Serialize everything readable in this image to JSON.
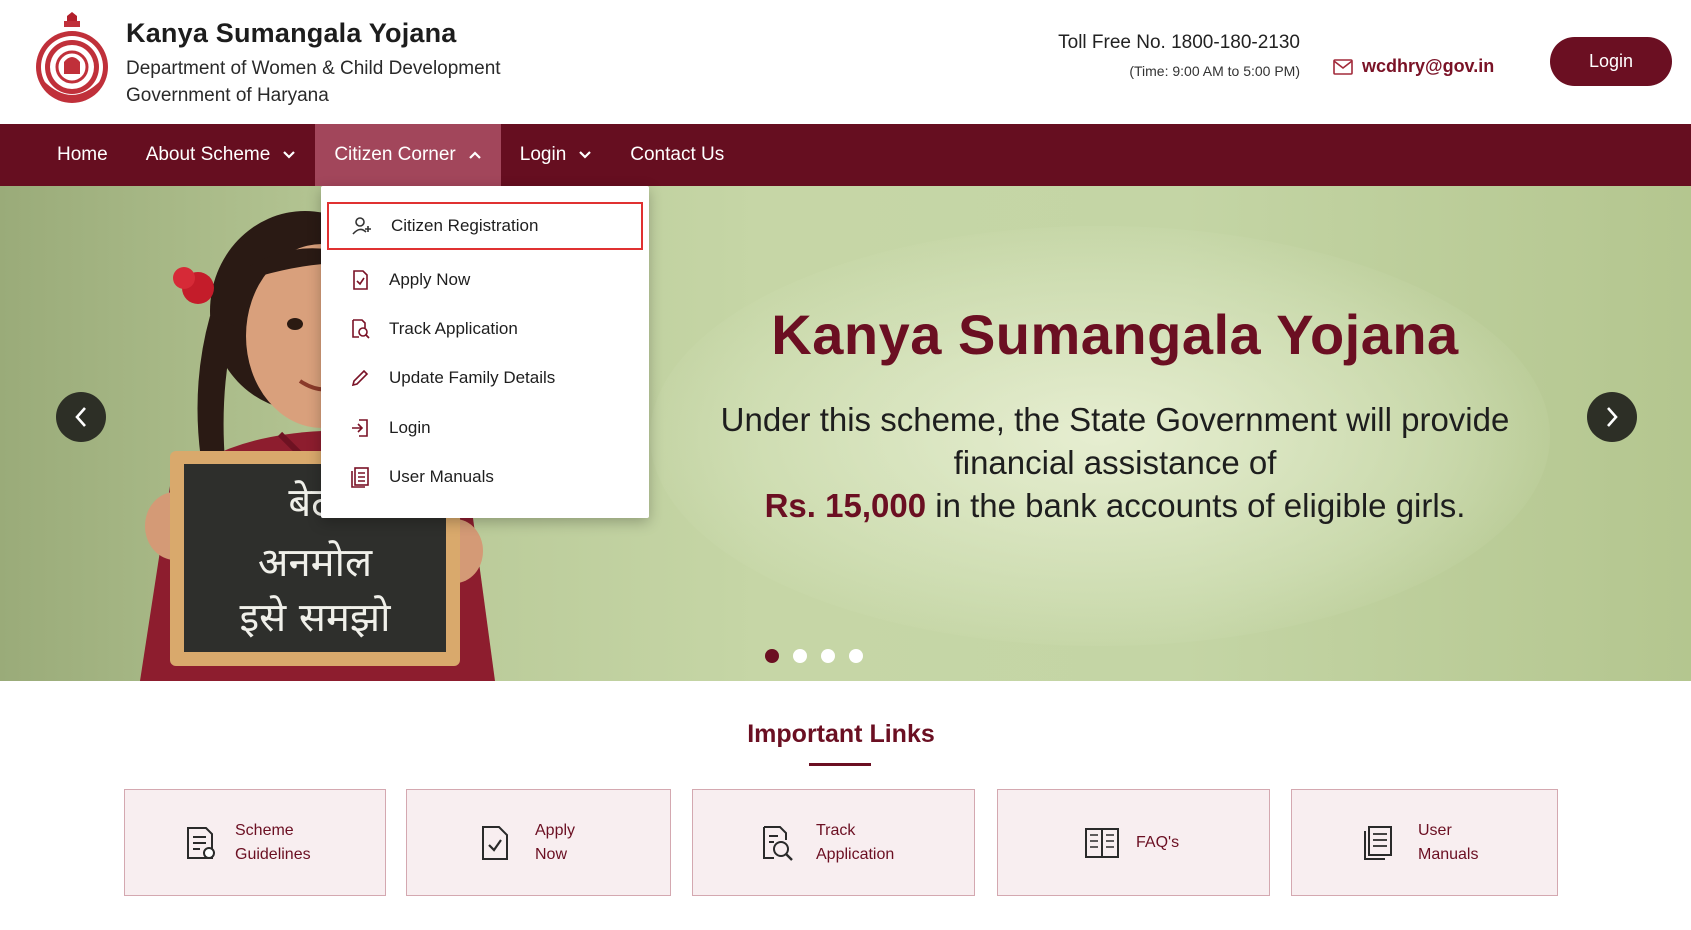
{
  "header": {
    "title": "Kanya Sumangala Yojana",
    "department": "Department of Women & Child Development",
    "government": "Government of Haryana",
    "tollfree": "Toll Free No. 1800-180-2130",
    "time": "(Time: 9:00 AM to 5:00 PM)",
    "email": "wcdhry@gov.in",
    "login_label": "Login"
  },
  "nav": {
    "home": "Home",
    "about": "About Scheme",
    "citizen": "Citizen Corner",
    "login": "Login",
    "contact": "Contact Us"
  },
  "dropdown": {
    "items": [
      {
        "label": "Citizen Registration",
        "icon": "user-plus-icon"
      },
      {
        "label": "Apply Now",
        "icon": "document-check-icon"
      },
      {
        "label": "Track Application",
        "icon": "document-search-icon"
      },
      {
        "label": "Update Family Details",
        "icon": "pencil-icon"
      },
      {
        "label": "Login",
        "icon": "login-arrow-icon"
      },
      {
        "label": "User Manuals",
        "icon": "manual-book-icon"
      }
    ],
    "selected_index": 0
  },
  "hero": {
    "title": "Kanya Sumangala Yojana",
    "text_before": "Under this scheme, the State Government will provide financial assistance of",
    "amount": "Rs. 15,000",
    "text_after": "in the bank accounts of eligible girls.",
    "slate_lines": [
      "बेटी",
      "अनमोल",
      "इसे समझो"
    ],
    "slide_count": 4,
    "active_slide": 1
  },
  "important_links": {
    "title": "Important Links",
    "cards": [
      {
        "line1": "Scheme",
        "line2": "Guidelines",
        "icon": "guidelines-icon"
      },
      {
        "line1": "Apply",
        "line2": "Now",
        "icon": "document-check-icon"
      },
      {
        "line1": "Track",
        "line2": "Application",
        "icon": "document-search-icon"
      },
      {
        "line1": "FAQ's",
        "line2": "",
        "icon": "faq-book-icon"
      },
      {
        "line1": "User",
        "line2": "Manuals",
        "icon": "manual-book-icon"
      }
    ]
  },
  "colors": {
    "primary": "#6b0f22",
    "nav_active": "#a2465b",
    "highlight_border": "#e03131",
    "card_bg": "#f8eef0"
  }
}
